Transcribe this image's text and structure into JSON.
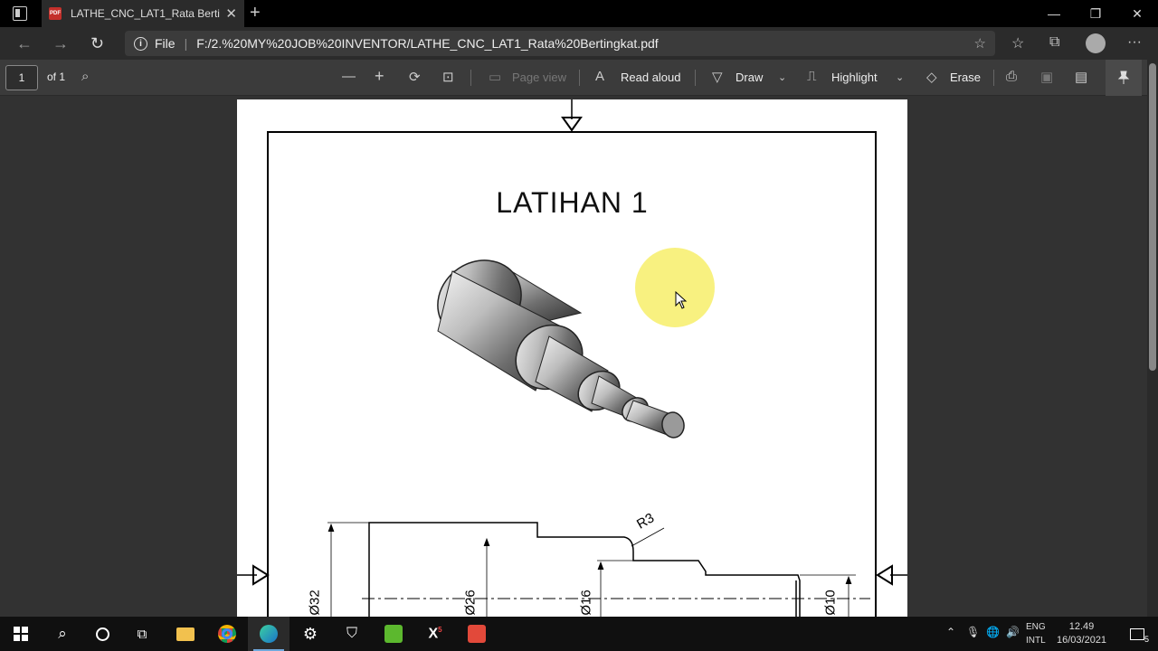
{
  "browser": {
    "tab_title": "LATHE_CNC_LAT1_Rata Bertingkat",
    "pdf_badge": "PDF",
    "new_tab": "+",
    "address_scheme": "File",
    "address_url": "F:/2.%20MY%20JOB%20INVENTOR/LATHE_CNC_LAT1_Rata%20Bertingkat.pdf"
  },
  "pdf_toolbar": {
    "page_number": "1",
    "page_total": "of 1",
    "page_view": "Page view",
    "read_aloud": "Read aloud",
    "draw": "Draw",
    "highlight": "Highlight",
    "erase": "Erase"
  },
  "document": {
    "title": "LATIHAN 1",
    "dims": {
      "r3": "R3",
      "d32": "Ø32",
      "d26": "Ø26",
      "d16": "Ø16",
      "d10": "Ø10"
    }
  },
  "taskbar": {
    "lang_top": "ENG",
    "lang_bottom": "INTL",
    "time": "12.49",
    "date": "16/03/2021",
    "notif_count": "5"
  },
  "colors": {
    "accent": "#6fa8dc",
    "highlight_circle": "#f7ee6a"
  }
}
